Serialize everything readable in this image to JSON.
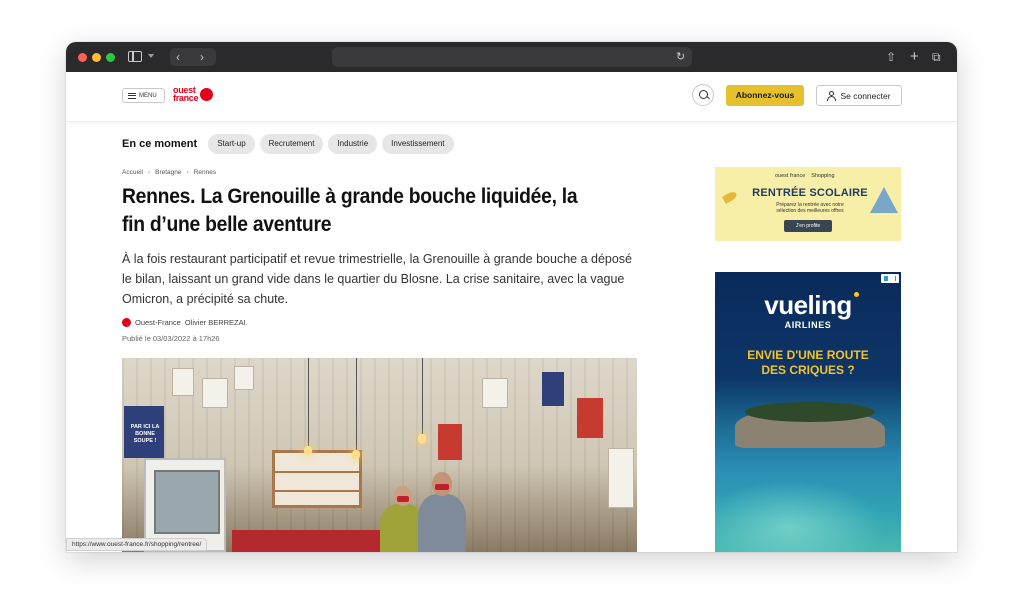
{
  "header": {
    "menu_label": "MENU",
    "logo_line1": "ouest",
    "logo_line2": "france",
    "subscribe_label": "Abonnez-vous",
    "login_label": "Se connecter"
  },
  "trending": {
    "label": "En ce moment",
    "chips": [
      "Start-up",
      "Recrutement",
      "Industrie",
      "Investissement"
    ]
  },
  "breadcrumb": [
    "Accueil",
    "Bretagne",
    "Rennes"
  ],
  "article": {
    "title": "Rennes. La Grenouille à grande bouche liquidée, la fin d’une belle aventure",
    "lead": "À la fois restaurant participatif et revue trimestrielle, la Grenouille à grande bouche a déposé le bilan, laissant un grand vide dans le quartier du Blosne. La crise sanitaire, avec la vague Omicron, a précipité sa chute.",
    "source": "Ouest-France",
    "author": "Olivier BERREZAI.",
    "published": "Publié le 03/03/2022 à 17h26",
    "photo_poster_text": "PAR ICI LA BONNE SOUPE !"
  },
  "ads": {
    "ad1": {
      "brand": "ouest france",
      "tag": "Shopping",
      "title": "RENTRÉE SCOLAIRE",
      "subtitle": "Préparez la rentrée avec notre sélection des meilleures offres",
      "button": "J'en profite"
    },
    "ad2": {
      "brand": "vueling",
      "sub": "AIRLINES",
      "slogan": "ENVIE D'UNE ROUTE DES CRIQUES ?"
    }
  },
  "status_url": "https://www.ouest-france.fr/shopping/rentree/",
  "colors": {
    "brand_red": "#e2001a",
    "subscribe_yellow": "#e5c12e",
    "titlebar": "#2a2a2c"
  }
}
